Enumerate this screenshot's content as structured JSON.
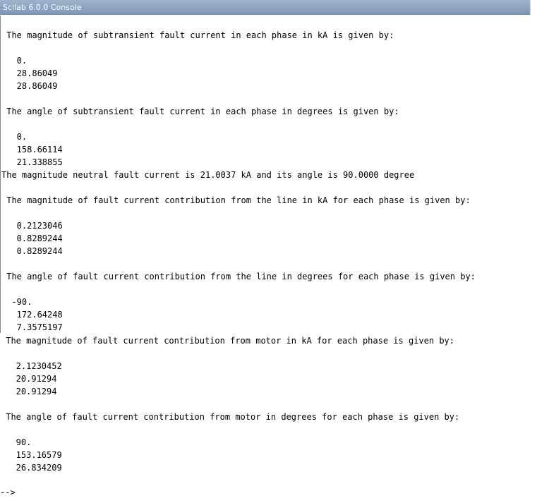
{
  "window": {
    "title": "Scilab 6.0.0 Console"
  },
  "console": {
    "lines": [
      " The magnitude of subtransient fault current in each phase in kA is given by:",
      "   0.",
      "   28.86049",
      "   28.86049",
      " The angle of subtransient fault current in each phase in degrees is given by:",
      "   0.",
      "   158.66114",
      "   21.338855",
      "The magnitude neutral fault current is 21.0037 kA and its angle is 90.0000 degree",
      " The magnitude of fault current contribution from the line in kA for each phase is given by:",
      "   0.2123046",
      "   0.8289244",
      "   0.8289244",
      " The angle of fault current contribution from the line in degrees for each phase is given by:",
      "  -90.",
      "   172.64248",
      "   7.3575197",
      " The magnitude of fault current contribution from motor in kA for each phase is given by:",
      "   2.1230452",
      "   20.91294",
      "   20.91294",
      " The angle of fault current contribution from motor in degrees for each phase is given by:",
      "   90.",
      "   153.16579",
      "   26.834209",
      "-->"
    ]
  }
}
